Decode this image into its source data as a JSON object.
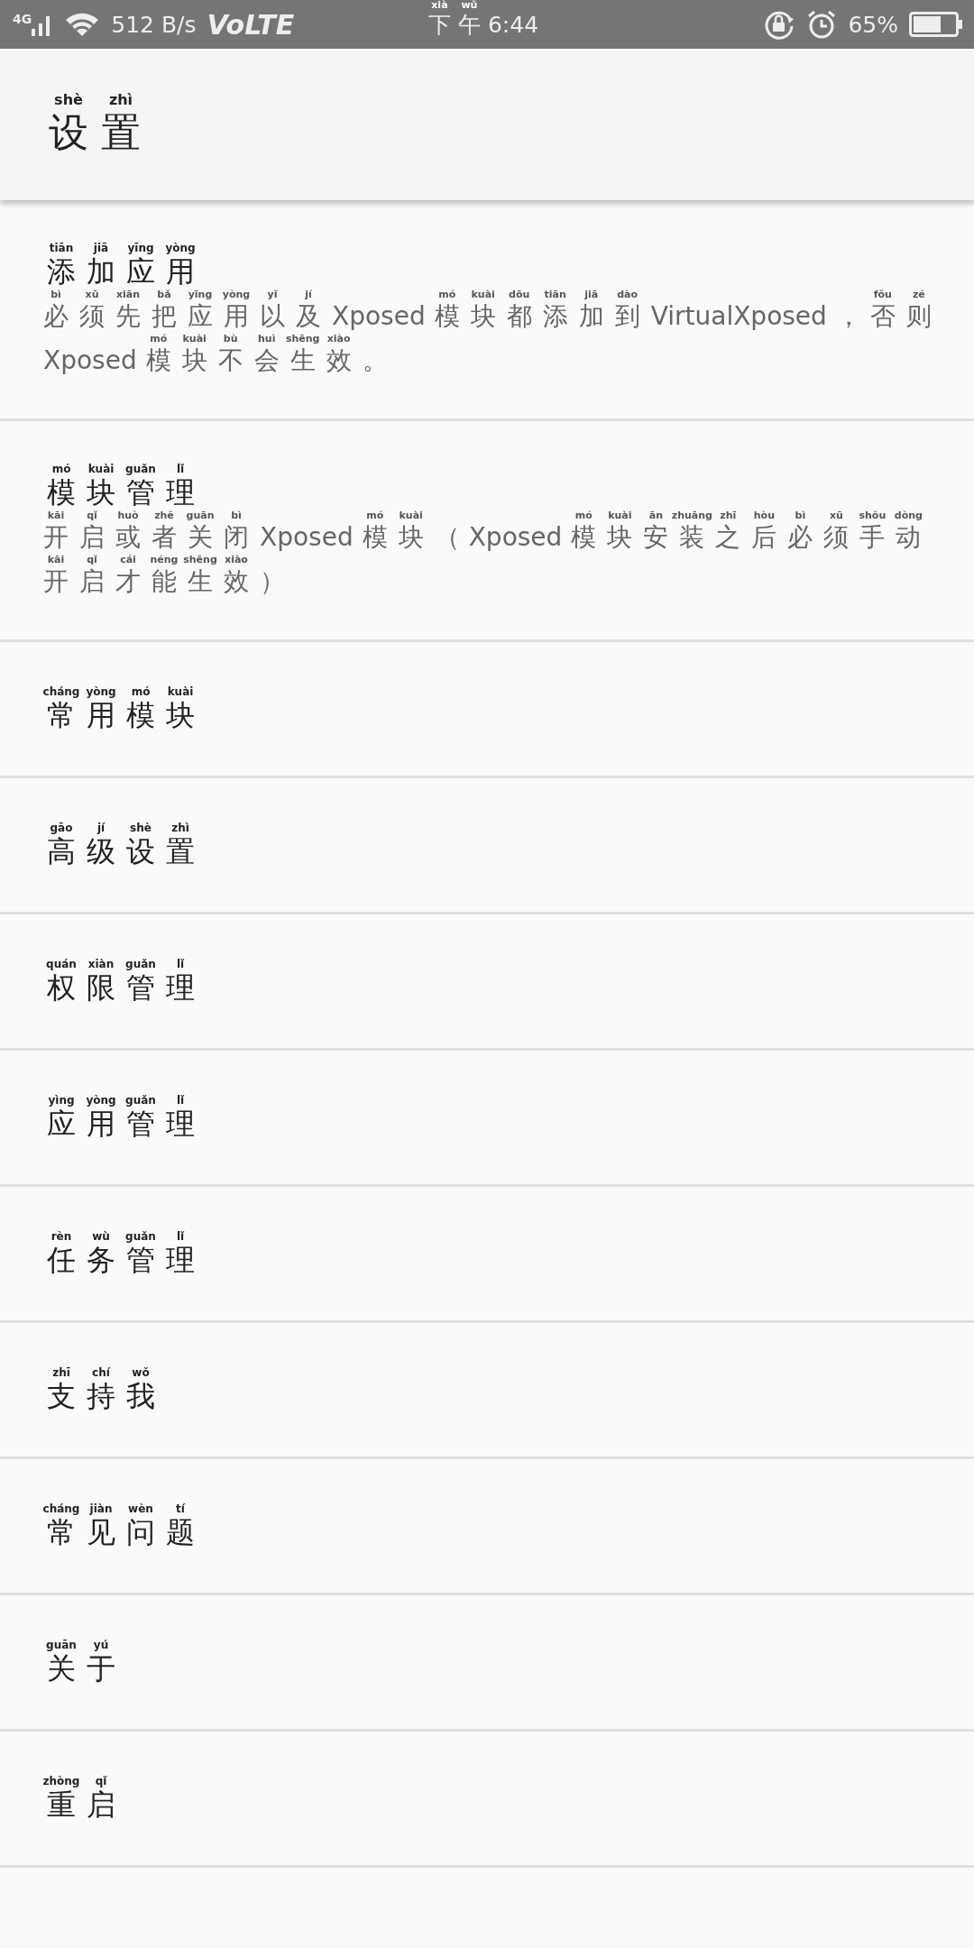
{
  "status_bar": {
    "network": "4G",
    "speed": "512 B/s",
    "volte": "VoLTE",
    "time": [
      {
        "pinyin": "xià",
        "text": "下"
      },
      {
        "pinyin": "wǔ",
        "text": "午"
      },
      {
        "text": "6:44"
      }
    ],
    "battery": "65%"
  },
  "app_bar": {
    "title": [
      {
        "pinyin": "shè",
        "text": "设"
      },
      {
        "pinyin": "zhì",
        "text": "置"
      }
    ]
  },
  "items": [
    {
      "title": [
        {
          "pinyin": "tiān",
          "text": "添"
        },
        {
          "pinyin": "jiā",
          "text": "加"
        },
        {
          "pinyin": "yīng",
          "text": "应"
        },
        {
          "pinyin": "yòng",
          "text": "用"
        }
      ],
      "description": [
        {
          "pinyin": "bì",
          "text": "必"
        },
        {
          "pinyin": "xū",
          "text": "须"
        },
        {
          "pinyin": "xiān",
          "text": "先"
        },
        {
          "pinyin": "bǎ",
          "text": "把"
        },
        {
          "pinyin": "yīng",
          "text": "应"
        },
        {
          "pinyin": "yòng",
          "text": "用"
        },
        {
          "pinyin": "yǐ",
          "text": "以"
        },
        {
          "pinyin": "jí",
          "text": "及"
        },
        {
          "text": "Xposed"
        },
        {
          "pinyin": "mó",
          "text": "模"
        },
        {
          "pinyin": "kuài",
          "text": "块"
        },
        {
          "pinyin": "dōu",
          "text": "都"
        },
        {
          "pinyin": "tiān",
          "text": "添"
        },
        {
          "pinyin": "jiā",
          "text": "加"
        },
        {
          "pinyin": "dào",
          "text": "到"
        },
        {
          "text": "VirtualXposed"
        },
        {
          "text": "，"
        },
        {
          "pinyin": "fǒu",
          "text": "否"
        },
        {
          "pinyin": "zé",
          "text": "则"
        },
        {
          "text": "Xposed"
        },
        {
          "pinyin": "mó",
          "text": "模"
        },
        {
          "pinyin": "kuài",
          "text": "块"
        },
        {
          "pinyin": "bù",
          "text": "不"
        },
        {
          "pinyin": "huì",
          "text": "会"
        },
        {
          "pinyin": "shēng",
          "text": "生"
        },
        {
          "pinyin": "xiào",
          "text": "效"
        },
        {
          "text": "。"
        }
      ]
    },
    {
      "title": [
        {
          "pinyin": "mó",
          "text": "模"
        },
        {
          "pinyin": "kuài",
          "text": "块"
        },
        {
          "pinyin": "guǎn",
          "text": "管"
        },
        {
          "pinyin": "lǐ",
          "text": "理"
        }
      ],
      "description": [
        {
          "pinyin": "kāi",
          "text": "开"
        },
        {
          "pinyin": "qǐ",
          "text": "启"
        },
        {
          "pinyin": "huò",
          "text": "或"
        },
        {
          "pinyin": "zhě",
          "text": "者"
        },
        {
          "pinyin": "guān",
          "text": "关"
        },
        {
          "pinyin": "bì",
          "text": "闭"
        },
        {
          "text": "Xposed"
        },
        {
          "pinyin": "mó",
          "text": "模"
        },
        {
          "pinyin": "kuài",
          "text": "块"
        },
        {
          "text": "（"
        },
        {
          "text": "Xposed"
        },
        {
          "pinyin": "mó",
          "text": "模"
        },
        {
          "pinyin": "kuài",
          "text": "块"
        },
        {
          "pinyin": "ān",
          "text": "安"
        },
        {
          "pinyin": "zhuāng",
          "text": "装"
        },
        {
          "pinyin": "zhī",
          "text": "之"
        },
        {
          "pinyin": "hòu",
          "text": "后"
        },
        {
          "pinyin": "bì",
          "text": "必"
        },
        {
          "pinyin": "xū",
          "text": "须"
        },
        {
          "pinyin": "shǒu",
          "text": "手"
        },
        {
          "pinyin": "dòng",
          "text": "动"
        },
        {
          "pinyin": "kāi",
          "text": "开"
        },
        {
          "pinyin": "qǐ",
          "text": "启"
        },
        {
          "pinyin": "cái",
          "text": "才"
        },
        {
          "pinyin": "néng",
          "text": "能"
        },
        {
          "pinyin": "shēng",
          "text": "生"
        },
        {
          "pinyin": "xiào",
          "text": "效"
        },
        {
          "text": "）"
        }
      ]
    },
    {
      "title": [
        {
          "pinyin": "cháng",
          "text": "常"
        },
        {
          "pinyin": "yòng",
          "text": "用"
        },
        {
          "pinyin": "mó",
          "text": "模"
        },
        {
          "pinyin": "kuài",
          "text": "块"
        }
      ]
    },
    {
      "title": [
        {
          "pinyin": "gāo",
          "text": "高"
        },
        {
          "pinyin": "jí",
          "text": "级"
        },
        {
          "pinyin": "shè",
          "text": "设"
        },
        {
          "pinyin": "zhì",
          "text": "置"
        }
      ]
    },
    {
      "title": [
        {
          "pinyin": "quán",
          "text": "权"
        },
        {
          "pinyin": "xiàn",
          "text": "限"
        },
        {
          "pinyin": "guǎn",
          "text": "管"
        },
        {
          "pinyin": "lǐ",
          "text": "理"
        }
      ]
    },
    {
      "title": [
        {
          "pinyin": "yìng",
          "text": "应"
        },
        {
          "pinyin": "yòng",
          "text": "用"
        },
        {
          "pinyin": "guǎn",
          "text": "管"
        },
        {
          "pinyin": "lǐ",
          "text": "理"
        }
      ]
    },
    {
      "title": [
        {
          "pinyin": "rèn",
          "text": "任"
        },
        {
          "pinyin": "wù",
          "text": "务"
        },
        {
          "pinyin": "guǎn",
          "text": "管"
        },
        {
          "pinyin": "lǐ",
          "text": "理"
        }
      ]
    },
    {
      "title": [
        {
          "pinyin": "zhī",
          "text": "支"
        },
        {
          "pinyin": "chí",
          "text": "持"
        },
        {
          "pinyin": "wǒ",
          "text": "我"
        }
      ]
    },
    {
      "title": [
        {
          "pinyin": "cháng",
          "text": "常"
        },
        {
          "pinyin": "jiàn",
          "text": "见"
        },
        {
          "pinyin": "wèn",
          "text": "问"
        },
        {
          "pinyin": "tí",
          "text": "题"
        }
      ]
    },
    {
      "title": [
        {
          "pinyin": "guān",
          "text": "关"
        },
        {
          "pinyin": "yú",
          "text": "于"
        }
      ]
    },
    {
      "title": [
        {
          "pinyin": "zhòng",
          "text": "重"
        },
        {
          "pinyin": "qǐ",
          "text": "启"
        }
      ]
    }
  ]
}
